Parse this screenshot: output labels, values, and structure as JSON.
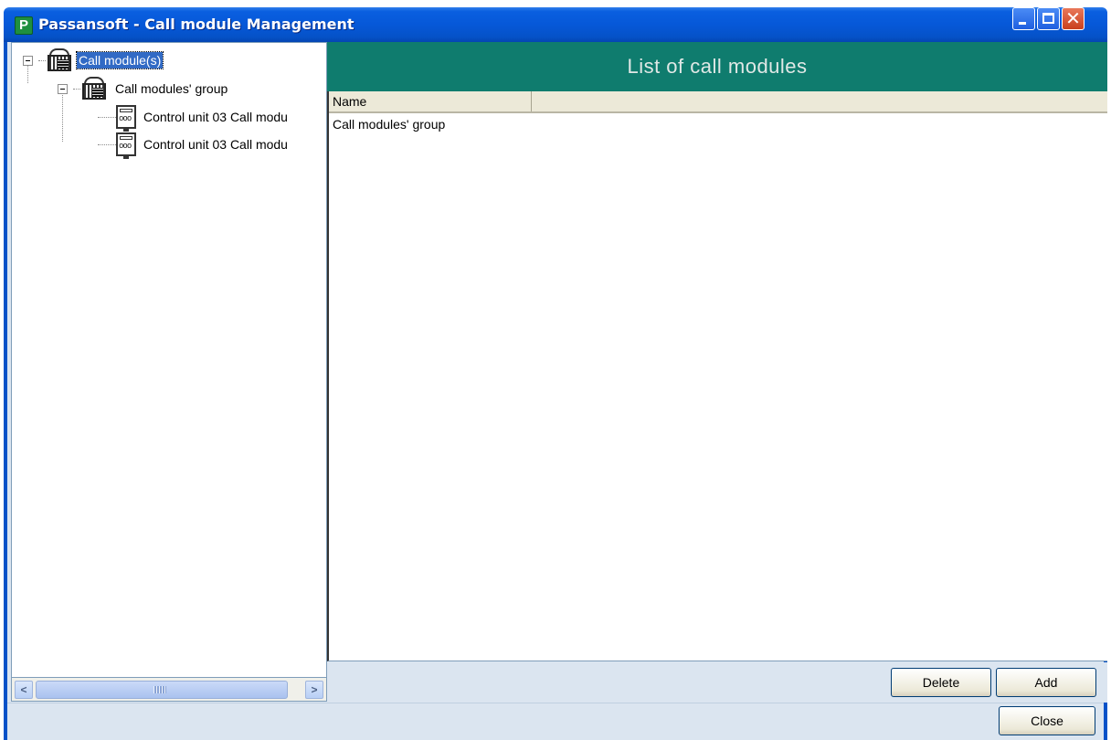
{
  "window": {
    "title": "Passansoft - Call module Management",
    "app_icon_letter": "P",
    "controls": {
      "minimize": "minimize-icon",
      "maximize": "maximize-icon",
      "close": "close-icon",
      "close_glyph": "✕"
    }
  },
  "tree": {
    "root": {
      "label": "Call module(s)",
      "icon": "building-icon",
      "selected": true
    },
    "group": {
      "label": "Call modules' group",
      "icon": "building-icon"
    },
    "units": [
      {
        "label": "Control unit 03 Call modu",
        "icon": "call-module-unit-icon"
      },
      {
        "label": "Control unit 03 Call modu",
        "icon": "call-module-unit-icon"
      }
    ]
  },
  "scrollbar": {
    "left_arrow": "<",
    "right_arrow": ">"
  },
  "main": {
    "header": "List of call modules",
    "columns": [
      "Name"
    ],
    "rows": [
      "Call modules' group"
    ]
  },
  "buttons": {
    "delete": "Delete",
    "add": "Add",
    "close": "Close"
  },
  "colors": {
    "titlebar": "#0658d8",
    "header_banner": "#0f7c6e",
    "selection": "#316ac5",
    "frame_bg": "#dbe5f0"
  }
}
